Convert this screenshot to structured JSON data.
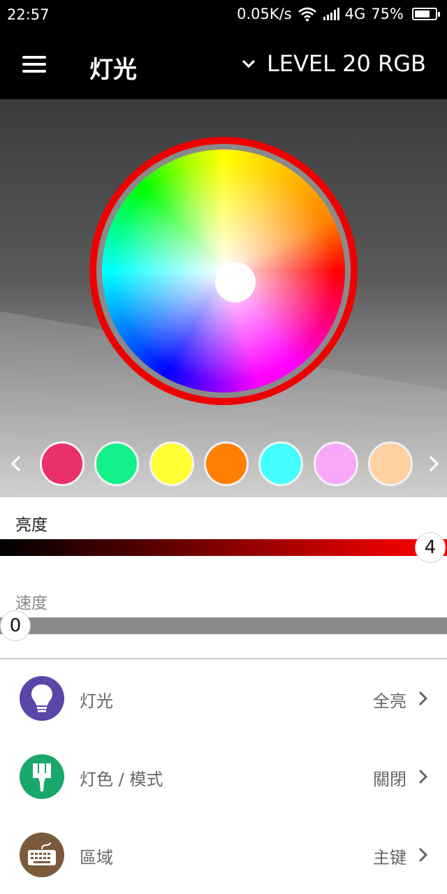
{
  "status": {
    "time": "22:57",
    "net_speed": "0.05K/s",
    "network": "4G",
    "battery_pct": "75%",
    "battery_level": 0.75
  },
  "app_bar": {
    "title": "灯光",
    "device": "LEVEL 20 RGB",
    "icons": [
      "menu-icon",
      "chevron-down-icon"
    ]
  },
  "color_wheel": {
    "ring_color": "#ee0000",
    "selected": "center",
    "presets": [
      "#e8306a",
      "#11f08a",
      "#ffff33",
      "#ff8000",
      "#44ffff",
      "#f8a8f8",
      "#ffd0a0"
    ]
  },
  "brightness": {
    "label": "亮度",
    "value": "4",
    "level": 1.0
  },
  "speed": {
    "label": "速度",
    "value": "0",
    "level": 0.0
  },
  "menu": [
    {
      "label": "灯光",
      "value": "全亮",
      "icon": "bulb-icon",
      "icon_color": "#5a45a8"
    },
    {
      "label": "灯色 / 模式",
      "value": "關閉",
      "icon": "brush-icon",
      "icon_color": "#1aa86a"
    },
    {
      "label": "區域",
      "value": "主键",
      "icon": "keyboard-icon",
      "icon_color": "#7a5a3a"
    }
  ]
}
